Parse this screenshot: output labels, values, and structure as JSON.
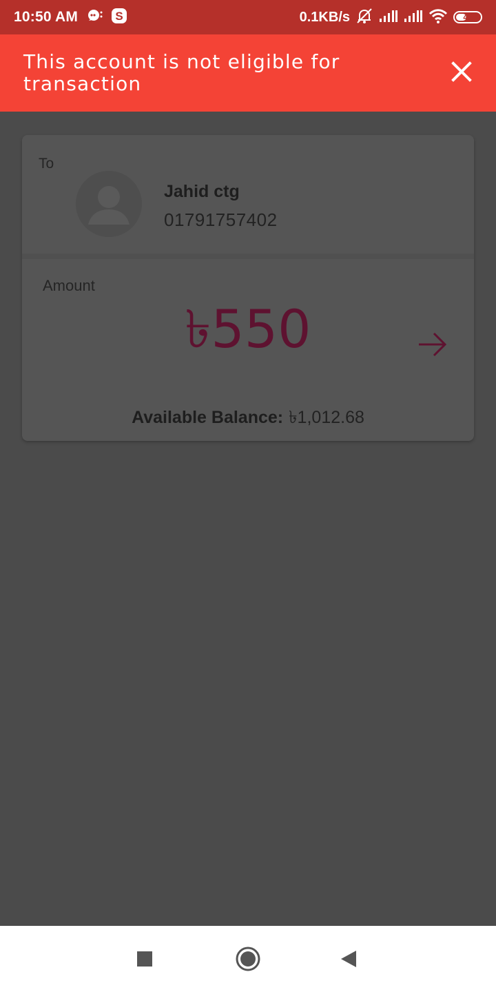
{
  "status_bar": {
    "time": "10:50 AM",
    "net_speed": "0.1KB/s",
    "battery_level": "40",
    "icons": [
      "chat-bubble-icon",
      "skype-icon",
      "mute-bell-icon",
      "signal-icon",
      "signal-icon",
      "wifi-icon",
      "battery-icon"
    ]
  },
  "banner": {
    "message": "This account is not eligible for transaction",
    "close_icon": "close-icon",
    "color": "#f44336"
  },
  "recipient": {
    "to_label": "To",
    "name": "Jahid ctg",
    "number": "01791757402",
    "avatar_icon": "avatar-placeholder-icon"
  },
  "amount": {
    "label": "Amount",
    "value": "৳550",
    "color": "#5e1230",
    "next_icon": "arrow-right-icon"
  },
  "balance": {
    "label": "Available Balance:",
    "value": "৳1,012.68"
  },
  "nav_bar": {
    "icons": [
      "recents-square-icon",
      "home-circle-icon",
      "back-triangle-icon"
    ]
  }
}
